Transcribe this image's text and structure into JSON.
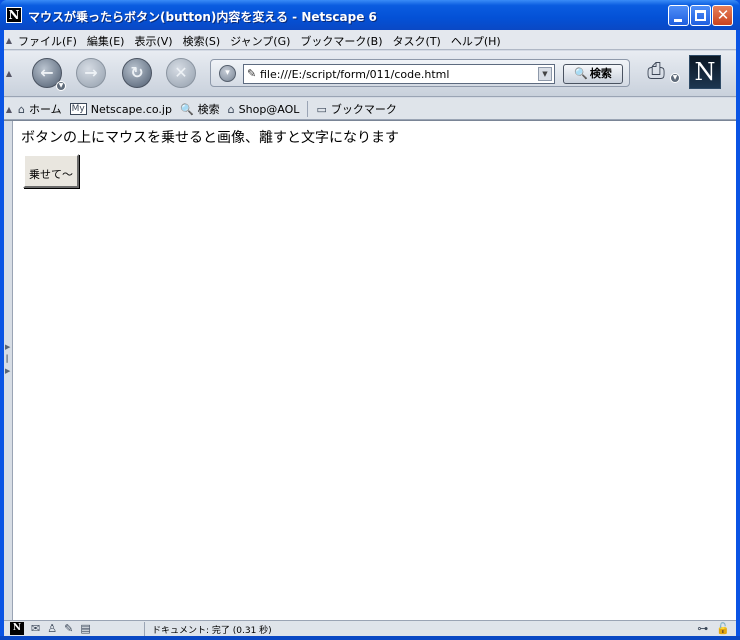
{
  "window": {
    "title": "マウスが乗ったらボタン(button)内容を変える - Netscape 6",
    "app_icon_letter": "N",
    "close_glyph": "✕"
  },
  "menubar": {
    "items": [
      "ファイル(F)",
      "編集(E)",
      "表示(V)",
      "検索(S)",
      "ジャンプ(G)",
      "ブックマーク(B)",
      "タスク(T)",
      "ヘルプ(H)"
    ]
  },
  "navigation": {
    "back_glyph": "←",
    "forward_glyph": "→",
    "reload_glyph": "↻",
    "stop_glyph": "✕",
    "address_value": "file:///E:/script/form/011/code.html",
    "search_label": "検索",
    "logo_letter": "N"
  },
  "personal_toolbar": {
    "home": "ホーム",
    "my_badge": "My",
    "netscape": "Netscape.co.jp",
    "search": "検索",
    "shop": "Shop@AOL",
    "bookmarks": "ブックマーク"
  },
  "page": {
    "text": "ボタンの上にマウスを乗せると画像、離すと文字になります",
    "button_label": "乗せて～"
  },
  "statusbar": {
    "status_text": "ドキュメント: 完了 (0.31 秒)"
  },
  "icons": {
    "back": "back-arrow-icon",
    "forward": "forward-arrow-icon",
    "reload": "reload-icon",
    "stop": "stop-icon",
    "print": "print-icon",
    "home": "home-icon",
    "search": "magnifier-icon",
    "shop": "shop-icon",
    "bookmarks": "folder-icon",
    "mail": "mail-icon",
    "aim": "instant-messenger-icon",
    "composer": "composer-icon",
    "address_book": "address-book-icon",
    "security": "lock-icon",
    "online": "online-plug-icon"
  }
}
